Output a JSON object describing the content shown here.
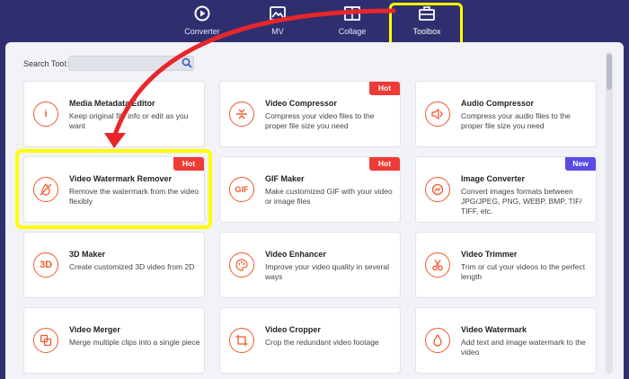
{
  "nav": {
    "items": [
      {
        "label": "Converter",
        "icon": "converter-icon"
      },
      {
        "label": "MV",
        "icon": "mv-icon"
      },
      {
        "label": "Collage",
        "icon": "collage-icon"
      },
      {
        "label": "Toolbox",
        "icon": "toolbox-icon",
        "active": true
      }
    ]
  },
  "search": {
    "label": "Search Tool:",
    "placeholder": ""
  },
  "tools": [
    {
      "title": "Media Metadata Editor",
      "desc": "Keep original file info or edit as you want",
      "icon": "info-icon",
      "badge": ""
    },
    {
      "title": "Video Compressor",
      "desc": "Compress your video files to the proper file size you need",
      "icon": "compress-icon",
      "badge": "Hot"
    },
    {
      "title": "Audio Compressor",
      "desc": "Compress your audio files to the proper file size you need",
      "icon": "audio-compress-icon",
      "badge": ""
    },
    {
      "title": "Video Watermark Remover",
      "desc": "Remove the watermark from the video flexibly",
      "icon": "watermark-remove-icon",
      "badge": "Hot"
    },
    {
      "title": "GIF Maker",
      "desc": "Make customized GIF with your video or image files",
      "icon": "gif-icon",
      "badge": "Hot"
    },
    {
      "title": "Image Converter",
      "desc": "Convert images formats between JPG/JPEG, PNG, WEBP, BMP, TIF/ TIFF, etc.",
      "icon": "image-convert-icon",
      "badge": "New"
    },
    {
      "title": "3D Maker",
      "desc": "Create customized 3D video from 2D",
      "icon": "3d-icon",
      "badge": ""
    },
    {
      "title": "Video Enhancer",
      "desc": "Improve your video quality in several ways",
      "icon": "palette-icon",
      "badge": ""
    },
    {
      "title": "Video Trimmer",
      "desc": "Trim or cut your videos to the perfect length",
      "icon": "scissors-icon",
      "badge": ""
    },
    {
      "title": "Video Merger",
      "desc": "Merge multiple clips into a single piece",
      "icon": "merge-icon",
      "badge": ""
    },
    {
      "title": "Video Cropper",
      "desc": "Crop the redundant video footage",
      "icon": "crop-icon",
      "badge": ""
    },
    {
      "title": "Video Watermark",
      "desc": "Add text and image watermark to the video",
      "icon": "drop-icon",
      "badge": ""
    }
  ],
  "icon_glyphs": {
    "info": "i",
    "gif": "GIF",
    "3d": "3D"
  },
  "colors": {
    "accent": "#f05a2a",
    "hot": "#ee3b36",
    "new": "#5a4be3",
    "highlight": "#ffff00",
    "arrow": "#e8262a",
    "header": "#2f2f6f"
  }
}
